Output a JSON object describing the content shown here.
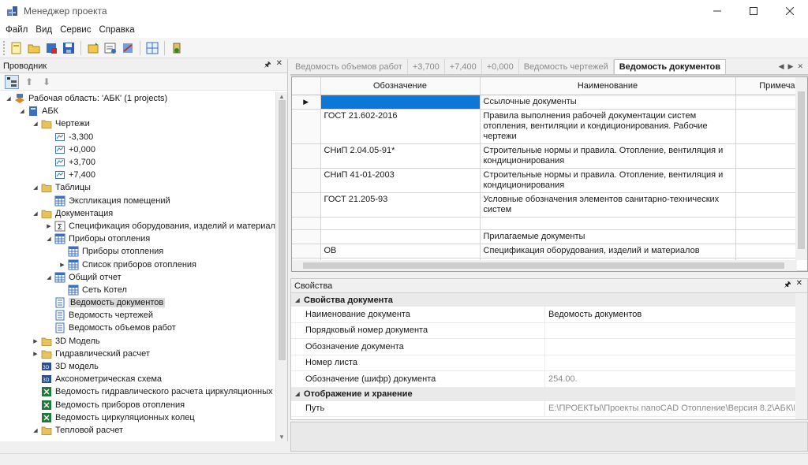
{
  "window": {
    "title": "Менеджер проекта"
  },
  "menu": [
    "Файл",
    "Вид",
    "Сервис",
    "Справка"
  ],
  "explorer": {
    "title": "Проводник",
    "tree": [
      {
        "label": "Рабочая область: 'АБК' (1 projects)",
        "icon": "workspace-icon",
        "level": 0,
        "expander": "expanded"
      },
      {
        "label": "АБК",
        "icon": "project-icon",
        "level": 1,
        "expander": "expanded"
      },
      {
        "label": "Чертежи",
        "icon": "folder-icon",
        "level": 2,
        "expander": "expanded"
      },
      {
        "label": "-3,300",
        "icon": "drawing-icon",
        "level": 3,
        "expander": "none"
      },
      {
        "label": "+0,000",
        "icon": "drawing-icon",
        "level": 3,
        "expander": "none"
      },
      {
        "label": "+3,700",
        "icon": "drawing-icon",
        "level": 3,
        "expander": "none"
      },
      {
        "label": "+7,400",
        "icon": "drawing-icon",
        "level": 3,
        "expander": "none"
      },
      {
        "label": "Таблицы",
        "icon": "folder-icon",
        "level": 2,
        "expander": "expanded"
      },
      {
        "label": "Экспликация помещений",
        "icon": "table-icon",
        "level": 3,
        "expander": "none"
      },
      {
        "label": "Документация",
        "icon": "folder-icon",
        "level": 2,
        "expander": "expanded"
      },
      {
        "label": "Спецификация оборудования, изделий и материал",
        "icon": "sigma-icon",
        "level": 3,
        "expander": "collapsed"
      },
      {
        "label": "Приборы отопления",
        "icon": "table-icon",
        "level": 3,
        "expander": "expanded"
      },
      {
        "label": "Приборы отопления",
        "icon": "table-icon",
        "level": 4,
        "expander": "none"
      },
      {
        "label": "Список приборов отопления",
        "icon": "table-icon",
        "level": 4,
        "expander": "collapsed"
      },
      {
        "label": "Общий отчет",
        "icon": "table-icon",
        "level": 3,
        "expander": "expanded"
      },
      {
        "label": "Сеть Котел",
        "icon": "table-icon",
        "level": 4,
        "expander": "none"
      },
      {
        "label": "Ведомость документов",
        "icon": "list-doc-icon",
        "level": 3,
        "expander": "none",
        "selected": true
      },
      {
        "label": "Ведомость чертежей",
        "icon": "list-doc-icon",
        "level": 3,
        "expander": "none"
      },
      {
        "label": "Ведомость объемов работ",
        "icon": "list-doc-icon",
        "level": 3,
        "expander": "none"
      },
      {
        "label": "3D Модель",
        "icon": "folder-icon",
        "level": 2,
        "expander": "collapsed"
      },
      {
        "label": "Гидравлический расчет",
        "icon": "folder-icon",
        "level": 2,
        "expander": "collapsed"
      },
      {
        "label": "3D модель",
        "icon": "model-3d-icon",
        "level": 2,
        "expander": "none"
      },
      {
        "label": "Аксонометрическая схема",
        "icon": "model-3d-icon",
        "level": 2,
        "expander": "none"
      },
      {
        "label": "Ведомость гидравлического расчета циркуляционных",
        "icon": "excel-icon",
        "level": 2,
        "expander": "none"
      },
      {
        "label": "Ведомость приборов отопления",
        "icon": "excel-icon",
        "level": 2,
        "expander": "none"
      },
      {
        "label": "Ведомость циркуляционных колец",
        "icon": "excel-icon",
        "level": 2,
        "expander": "none"
      },
      {
        "label": "Тепловой расчет",
        "icon": "folder-icon",
        "level": 2,
        "expander": "expanded"
      }
    ]
  },
  "tabs": [
    {
      "label": "Ведомость объемов работ",
      "active": false
    },
    {
      "label": "+3,700",
      "active": false
    },
    {
      "label": "+7,400",
      "active": false
    },
    {
      "label": "+0,000",
      "active": false
    },
    {
      "label": "Ведомость чертежей",
      "active": false
    },
    {
      "label": "Ведомость документов",
      "active": true
    }
  ],
  "grid": {
    "columns": [
      "Обозначение",
      "Наименование",
      "Примечани"
    ],
    "rows": [
      {
        "designation": "",
        "name": "Ссылочные документы",
        "note": "",
        "current": true
      },
      {
        "designation": "ГОСТ 21.602-2016",
        "name": "Правила выполнения рабочей документации систем отопления, вентиляции и кондиционирования. Рабочие чертежи",
        "note": ""
      },
      {
        "designation": "СНиП 2.04.05-91*",
        "name": "Строительные нормы и правила. Отопление, вентиляция и кондиционирования",
        "note": ""
      },
      {
        "designation": "СНиП 41-01-2003",
        "name": "Строительные нормы и правила. Отопление, вентиляция и кондиционирования",
        "note": ""
      },
      {
        "designation": "ГОСТ 21.205-93",
        "name": "Условные обозначения элементов санитарно-технических систем",
        "note": ""
      },
      {
        "designation": "",
        "name": "",
        "note": ""
      },
      {
        "designation": "",
        "name": "Прилагаемые документы",
        "note": ""
      },
      {
        "designation": "ОВ",
        "name": "Спецификация оборудования, изделий и материалов",
        "note": ""
      },
      {
        "designation": "",
        "name": "",
        "note": ""
      }
    ]
  },
  "properties": {
    "title": "Свойства",
    "categories": [
      {
        "name": "Свойства документа",
        "items": [
          {
            "name": "Наименование документа",
            "value": "Ведомость документов",
            "grey": false
          },
          {
            "name": "Порядковый номер документа",
            "value": "",
            "grey": false
          },
          {
            "name": "Обозначение документа",
            "value": "",
            "grey": false
          },
          {
            "name": "Номер листа",
            "value": "",
            "grey": false
          },
          {
            "name": "Обозначение (шифр) документа",
            "value": "254.00.",
            "grey": true
          }
        ]
      },
      {
        "name": "Отображение и хранение",
        "items": [
          {
            "name": "Путь",
            "value": "E:\\ПРОЕКТЫ\\Проекты nanoCAD Отопление\\Версия 8.2\\АБК\\Вед",
            "grey": true
          }
        ]
      }
    ]
  }
}
